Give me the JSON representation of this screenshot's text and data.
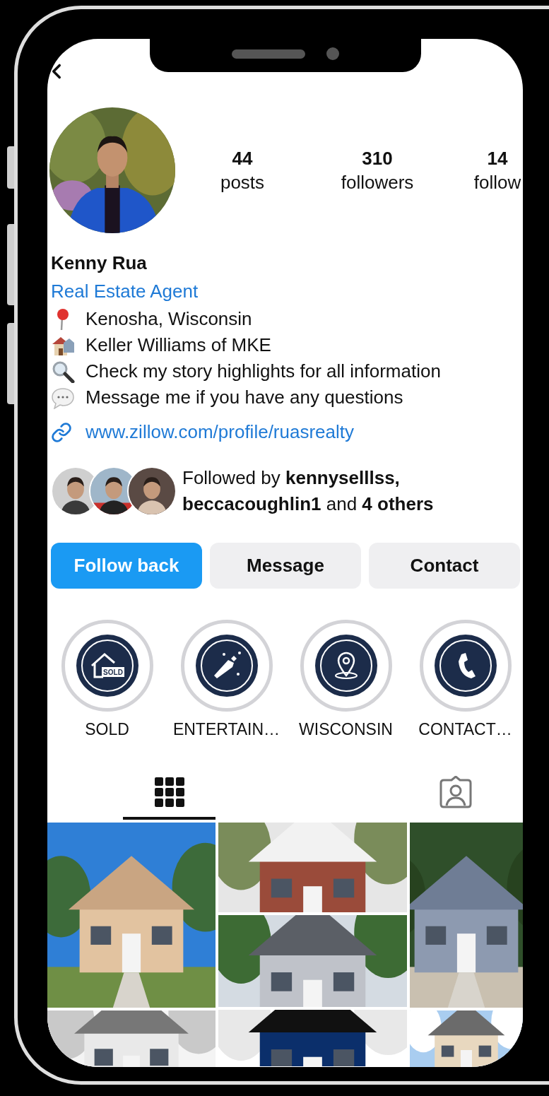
{
  "stats": [
    {
      "value": "44",
      "label": "posts"
    },
    {
      "value": "310",
      "label": "followers"
    },
    {
      "value": "14",
      "label": "follow"
    }
  ],
  "name": "Kenny Rua",
  "category": "Real Estate Agent",
  "bio": [
    {
      "kind": "pin",
      "text": "Kenosha, Wisconsin"
    },
    {
      "kind": "house",
      "text": "Keller Williams of MKE"
    },
    {
      "kind": "magnifier",
      "text": "Check my story highlights for all information"
    },
    {
      "kind": "speech",
      "text": "Message me if you have any questions"
    }
  ],
  "link": "www.zillow.com/profile/ruasrealty",
  "followed_by": [
    "Followed by **kennyselllss,**",
    "**beccacoughlin1** and **4 others**"
  ],
  "buttons": [
    {
      "label": "Follow back",
      "kind": "primary"
    },
    {
      "label": "Message",
      "kind": "secondary"
    },
    {
      "label": "Contact",
      "kind": "secondary"
    }
  ],
  "highlights": [
    {
      "label": "SOLD",
      "kind": "sold",
      "sign": "SOLD"
    },
    {
      "label": "ENTERTAIN…",
      "kind": "party"
    },
    {
      "label": "WISCONSIN",
      "kind": "location"
    },
    {
      "label": "CONTACT…",
      "kind": "phone"
    }
  ],
  "tabs": [
    {
      "kind": "grid",
      "selected": true
    },
    {
      "kind": "tagged",
      "selected": false
    }
  ],
  "posts": [
    [
      {
        "kind": "picture"
      },
      {
        "kind": "picture"
      }
    ],
    [
      {
        "kind": "picture"
      },
      {
        "kind": "picture"
      },
      {
        "kind": "picture"
      }
    ],
    [
      {
        "kind": "picture"
      },
      {
        "kind": "picture"
      }
    ]
  ]
}
